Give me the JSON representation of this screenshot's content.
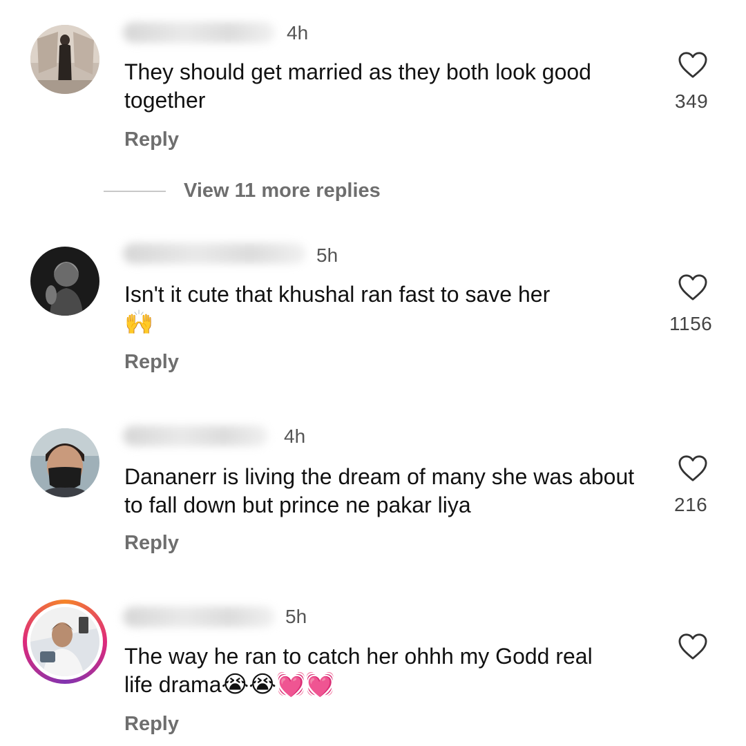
{
  "comments": [
    {
      "time": "4h",
      "text": "They should get married as they both look good together",
      "likes": "349",
      "reply_label": "Reply",
      "avatar": "avatar-person-standing",
      "view_more": "View 11 more replies"
    },
    {
      "time": "5h",
      "text": "Isn't it cute that khushal ran fast to save her",
      "emoji": "🙌",
      "likes": "1156",
      "reply_label": "Reply",
      "avatar": "avatar-dark-portrait"
    },
    {
      "time": "4h",
      "text": "Dananerr is living the dream of many she was about to fall down but prince ne pakar liya",
      "likes": "216",
      "reply_label": "Reply",
      "avatar": "avatar-man-mask"
    },
    {
      "time": "5h",
      "text": "The way he ran to catch her ohhh my Godd real life drama",
      "emoji": "😭😭💓💓",
      "reply_label": "Reply",
      "avatar": "avatar-story-ring"
    }
  ],
  "icons": {
    "like": "heart-outline-icon"
  },
  "colors": {
    "story_ring_start": "#f58529",
    "story_ring_end": "#8134af"
  }
}
